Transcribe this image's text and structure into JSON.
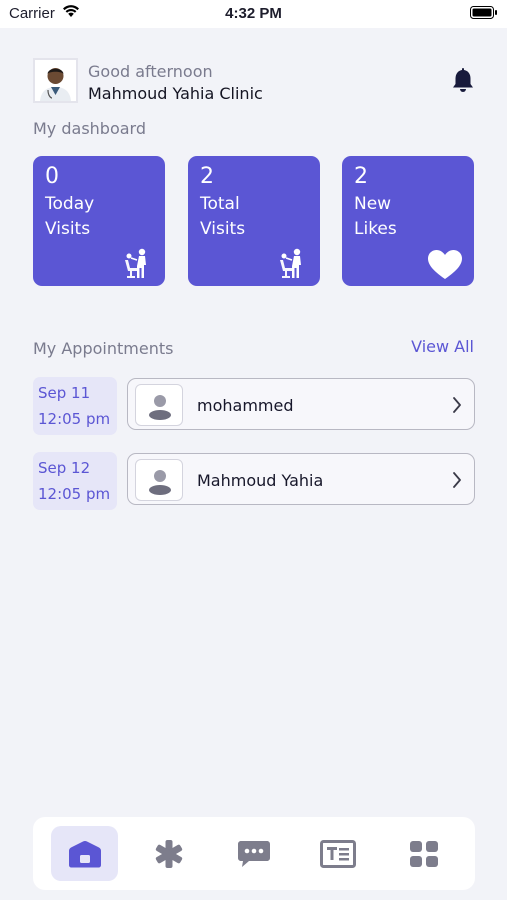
{
  "status_bar": {
    "carrier": "Carrier",
    "time": "4:32 PM"
  },
  "header": {
    "greeting": "Good afternoon",
    "clinic_name": "Mahmoud Yahia Clinic"
  },
  "dashboard": {
    "label": "My dashboard",
    "cards": [
      {
        "count": "0",
        "line1": "Today",
        "line2": "Visits",
        "icon": "dental-chair-icon"
      },
      {
        "count": "2",
        "line1": "Total",
        "line2": "Visits",
        "icon": "dental-chair-icon"
      },
      {
        "count": "2",
        "line1": "New",
        "line2": "Likes",
        "icon": "heart-icon"
      }
    ]
  },
  "appointments": {
    "label": "My Appointments",
    "view_all": "View All",
    "items": [
      {
        "date": "Sep 11",
        "time": "12:05 pm",
        "name": "mohammed"
      },
      {
        "date": "Sep 12",
        "time": "12:05 pm",
        "name": "Mahmoud Yahia"
      }
    ]
  },
  "bottom_nav": {
    "items": [
      {
        "icon": "home-icon",
        "active": true
      },
      {
        "icon": "asterisk-icon",
        "active": false
      },
      {
        "icon": "chat-icon",
        "active": false
      },
      {
        "icon": "article-icon",
        "active": false
      },
      {
        "icon": "grid-icon",
        "active": false
      }
    ]
  },
  "colors": {
    "accent": "#5b56d4",
    "background": "#f2f3f8",
    "active_tab_bg": "#e6e6f8",
    "bell": "#181a3c",
    "muted_text": "#7a7b8e"
  }
}
